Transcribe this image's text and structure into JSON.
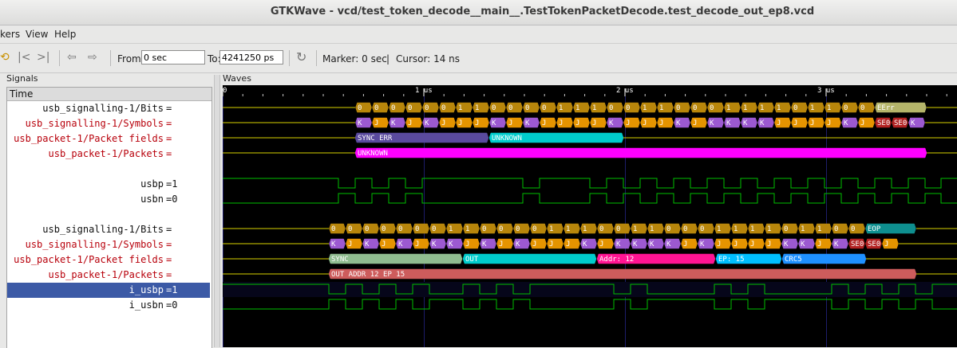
{
  "window": {
    "title": "GTKWave - vcd/test_token_decode__main__.TestTokenPacketDecode.test_decode_out_ep8.vcd"
  },
  "menu": {
    "items": [
      "kers",
      "View",
      "Help"
    ]
  },
  "toolbar": {
    "from_label": "From:",
    "from_value": "0 sec",
    "to_label": "To:",
    "to_value": "4241250 ps",
    "marker_label": "Marker: 0 sec",
    "separator": "|",
    "cursor_label": "Cursor: 14 ns"
  },
  "signals_panel": {
    "title": "Signals",
    "time_header": "Time",
    "rows": [
      {
        "name": "usb_signalling-1/Bits",
        "value": "=",
        "color": "black",
        "selected": false
      },
      {
        "name": "usb_signalling-1/Symbols",
        "value": "=",
        "color": "red",
        "selected": false
      },
      {
        "name": "usb_packet-1/Packet fields",
        "value": "=",
        "color": "red",
        "selected": false
      },
      {
        "name": "usb_packet-1/Packets",
        "value": "=",
        "color": "red",
        "selected": false
      },
      {
        "name": "",
        "value": "",
        "color": "black",
        "selected": false
      },
      {
        "name": "usbp",
        "value": "=1",
        "color": "black",
        "selected": false
      },
      {
        "name": "usbn",
        "value": "=0",
        "color": "black",
        "selected": false
      },
      {
        "name": "",
        "value": "",
        "color": "black",
        "selected": false
      },
      {
        "name": "usb_signalling-1/Bits",
        "value": "=",
        "color": "black",
        "selected": false
      },
      {
        "name": "usb_signalling-1/Symbols",
        "value": "=",
        "color": "red",
        "selected": false
      },
      {
        "name": "usb_packet-1/Packet fields",
        "value": "=",
        "color": "red",
        "selected": false
      },
      {
        "name": "usb_packet-1/Packets",
        "value": "=",
        "color": "red",
        "selected": false
      },
      {
        "name": "i_usbp",
        "value": "=1",
        "color": "black",
        "selected": true
      },
      {
        "name": "i_usbn",
        "value": "=0",
        "color": "black",
        "selected": false
      }
    ]
  },
  "waves_panel": {
    "title": "Waves",
    "ruler": {
      "zero": "0",
      "ticks": [
        "1 us",
        "2 us",
        "3 us"
      ]
    },
    "group1": {
      "bits": [
        "0",
        "0",
        "0",
        "0",
        "0",
        "0",
        "1",
        "1",
        "0",
        "0",
        "0",
        "0",
        "1",
        "1",
        "1",
        "0",
        "0",
        "1",
        "1",
        "0",
        "0",
        "0",
        "1",
        "1",
        "1",
        "1",
        "0",
        "1",
        "1",
        "0",
        "0",
        "EErr"
      ],
      "symbols": [
        "K",
        "J",
        "K",
        "J",
        "K",
        "J",
        "J",
        "J",
        "K",
        "J",
        "K",
        "J",
        "J",
        "J",
        "J",
        "K",
        "J",
        "J",
        "J",
        "K",
        "J",
        "K",
        "K",
        "K",
        "K",
        "J",
        "J",
        "J",
        "J",
        "K",
        "J",
        "SE0",
        "SE0",
        "K"
      ],
      "fields": [
        {
          "label": "SYNC ERR",
          "color": "#5a4a9e"
        },
        {
          "label": "UNKNOWN",
          "color": "#00cccc"
        }
      ],
      "packet": {
        "label": "UNKNOWN",
        "color": "#ff00ff"
      }
    },
    "group2": {
      "bits": [
        "0",
        "0",
        "0",
        "0",
        "0",
        "0",
        "0",
        "1",
        "1",
        "0",
        "0",
        "0",
        "0",
        "1",
        "1",
        "1",
        "0",
        "0",
        "1",
        "1",
        "0",
        "0",
        "0",
        "1",
        "1",
        "1",
        "1",
        "0",
        "1",
        "1",
        "0",
        "0",
        "EOP"
      ],
      "symbols": [
        "K",
        "J",
        "K",
        "J",
        "K",
        "J",
        "K",
        "K",
        "J",
        "K",
        "J",
        "K",
        "J",
        "J",
        "J",
        "K",
        "J",
        "K",
        "K",
        "K",
        "K",
        "J",
        "K",
        "J",
        "J",
        "J",
        "J",
        "K",
        "K",
        "J",
        "K",
        "SE0",
        "SE0",
        "J"
      ],
      "fields": [
        {
          "label": "SYNC",
          "color": "#8fbc8f"
        },
        {
          "label": "OUT",
          "color": "#00cccc"
        },
        {
          "label": "Addr: 12",
          "color": "#ff1493"
        },
        {
          "label": "EP: 15",
          "color": "#00bfff"
        },
        {
          "label": "CRC5",
          "color": "#1e90ff"
        }
      ],
      "packet": {
        "label": "OUT ADDR 12 EP 15",
        "color": "#cd5c5c"
      }
    },
    "colors": {
      "bits": "#b8860b",
      "sym_k": "#9c59d1",
      "sym_j": "#e59400",
      "sym_se0": "#b22222",
      "eerr": "#b5b56a",
      "eop": "#0e8f8f",
      "wire": "#00c000"
    }
  }
}
